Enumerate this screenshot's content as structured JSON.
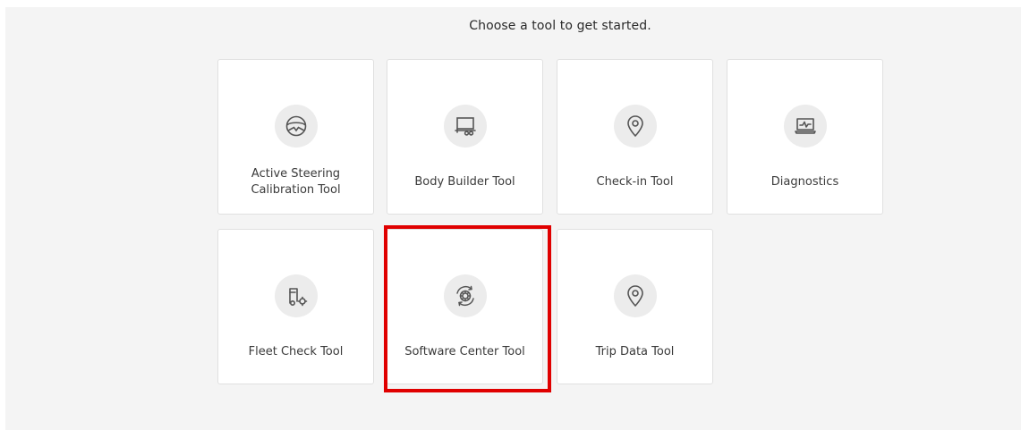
{
  "header": {
    "subtitle": "Choose a tool to get started."
  },
  "tools": [
    {
      "label": "Active Steering Calibration Tool",
      "icon": "steering-wheel-icon"
    },
    {
      "label": "Body Builder Tool",
      "icon": "truck-body-icon"
    },
    {
      "label": "Check-in Tool",
      "icon": "location-pin-icon"
    },
    {
      "label": "Diagnostics",
      "icon": "laptop-waveform-icon"
    },
    {
      "label": "Fleet Check Tool",
      "icon": "truck-gear-icon"
    },
    {
      "label": "Software Center Tool",
      "icon": "gear-refresh-icon",
      "highlighted": true
    },
    {
      "label": "Trip Data Tool",
      "icon": "location-pin-icon"
    }
  ],
  "colors": {
    "background": "#f4f4f4",
    "tile": "#ffffff",
    "icon_circle": "#ececec",
    "highlight": "#e00000",
    "text": "#3a3a3a"
  }
}
